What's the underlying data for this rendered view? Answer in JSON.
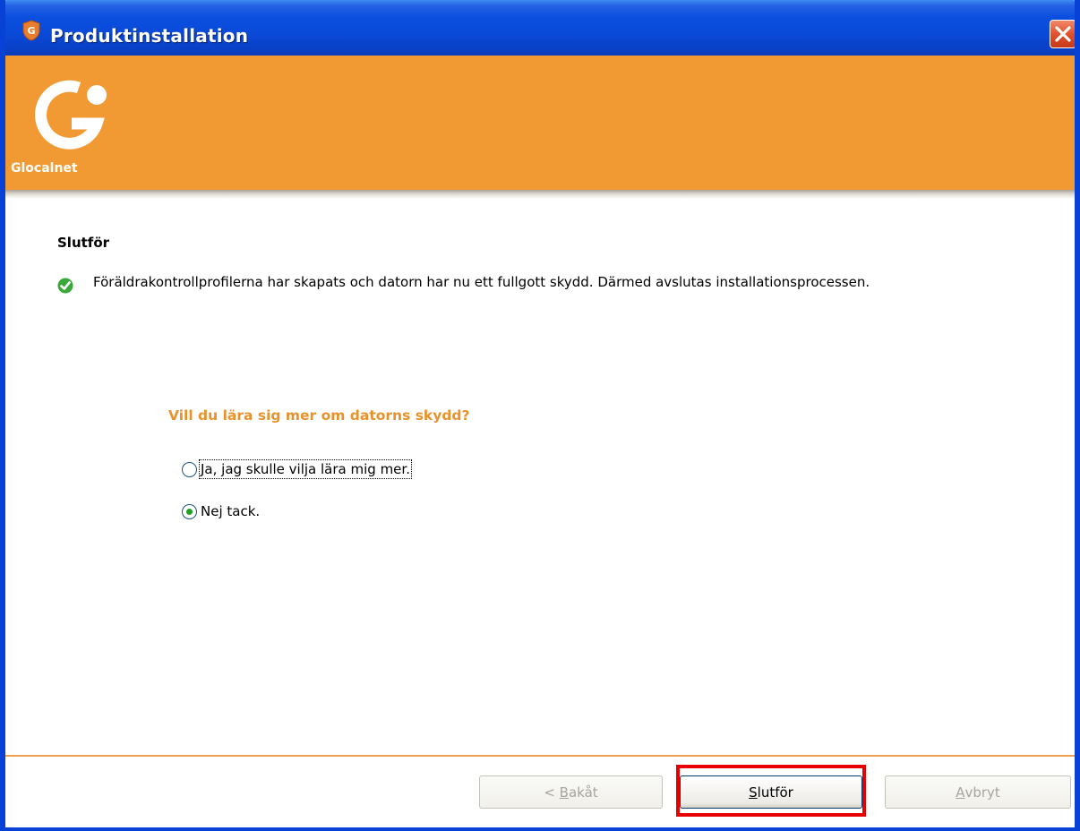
{
  "window": {
    "title": "Produktinstallation"
  },
  "header": {
    "logo_text": "Glocalnet",
    "logo_icon": "glocalnet-g-logo",
    "brand_color": "#f19a33"
  },
  "content": {
    "section_title": "Slutför",
    "status_icon": "check-circle-icon",
    "message": "Föräldrakontrollprofilerna har skapats och datorn har nu ett fullgott skydd. Därmed avslutas installationsprocessen.",
    "question": "Vill du lära sig mer om datorns skydd?",
    "options": [
      {
        "label": "Ja, jag skulle vilja lära mig mer.",
        "selected": false
      },
      {
        "label": "Nej tack.",
        "selected": true
      }
    ]
  },
  "buttons": {
    "back": {
      "prefix": "< ",
      "mnemonic": "B",
      "rest": "akåt",
      "enabled": false
    },
    "finish": {
      "mnemonic": "S",
      "rest": "lutför",
      "enabled": true
    },
    "cancel": {
      "mnemonic": "A",
      "rest": "vbryt",
      "enabled": false
    }
  },
  "colors": {
    "titlebar": "#0a4ad8",
    "accent_orange": "#e8922c",
    "highlight": "#e60000"
  }
}
